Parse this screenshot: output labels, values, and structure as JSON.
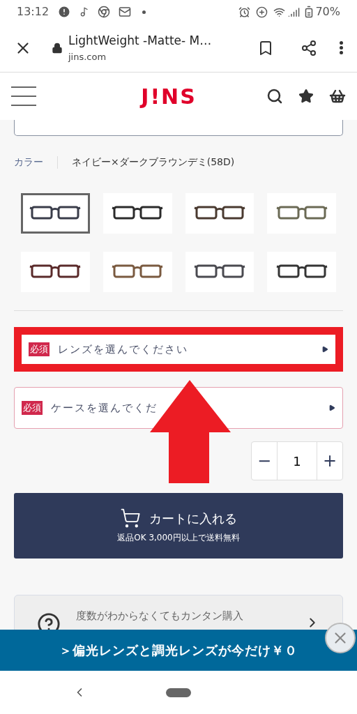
{
  "status_bar": {
    "time": "13:12",
    "battery": "70%"
  },
  "browser": {
    "title": "LightWeight -Matte- M…",
    "domain": "jins.com"
  },
  "site_header": {
    "logo": "J!NS"
  },
  "color_section": {
    "label": "カラー",
    "value": "ネイビー×ダークブラウンデミ(58D)",
    "swatches": [
      {
        "selected": true,
        "color": "#3a3d4a"
      },
      {
        "selected": false,
        "color": "#2b2b2b"
      },
      {
        "selected": false,
        "color": "#4a3a30"
      },
      {
        "selected": false,
        "color": "#6b6a55"
      },
      {
        "selected": false,
        "color": "#5a2a2a"
      },
      {
        "selected": false,
        "color": "#7a5a40"
      },
      {
        "selected": false,
        "color": "#4a4a50"
      },
      {
        "selected": false,
        "color": "#353535"
      }
    ]
  },
  "selectors": [
    {
      "badge": "必須",
      "label": "レンズを選んでください",
      "highlighted": true
    },
    {
      "badge": "必須",
      "label": "ケースを選んでくだ",
      "highlighted": false
    }
  ],
  "quantity": {
    "minus": "−",
    "value": "1",
    "plus": "+"
  },
  "cart_button": {
    "label": "カートに入れる",
    "note": "返品OK 3,000円以上で送料無料"
  },
  "help_card": {
    "text": "度数がわからなくてもカンタン購入"
  },
  "banner": {
    "text": "＞偏光レンズと調光レンズが今だけ￥０"
  }
}
